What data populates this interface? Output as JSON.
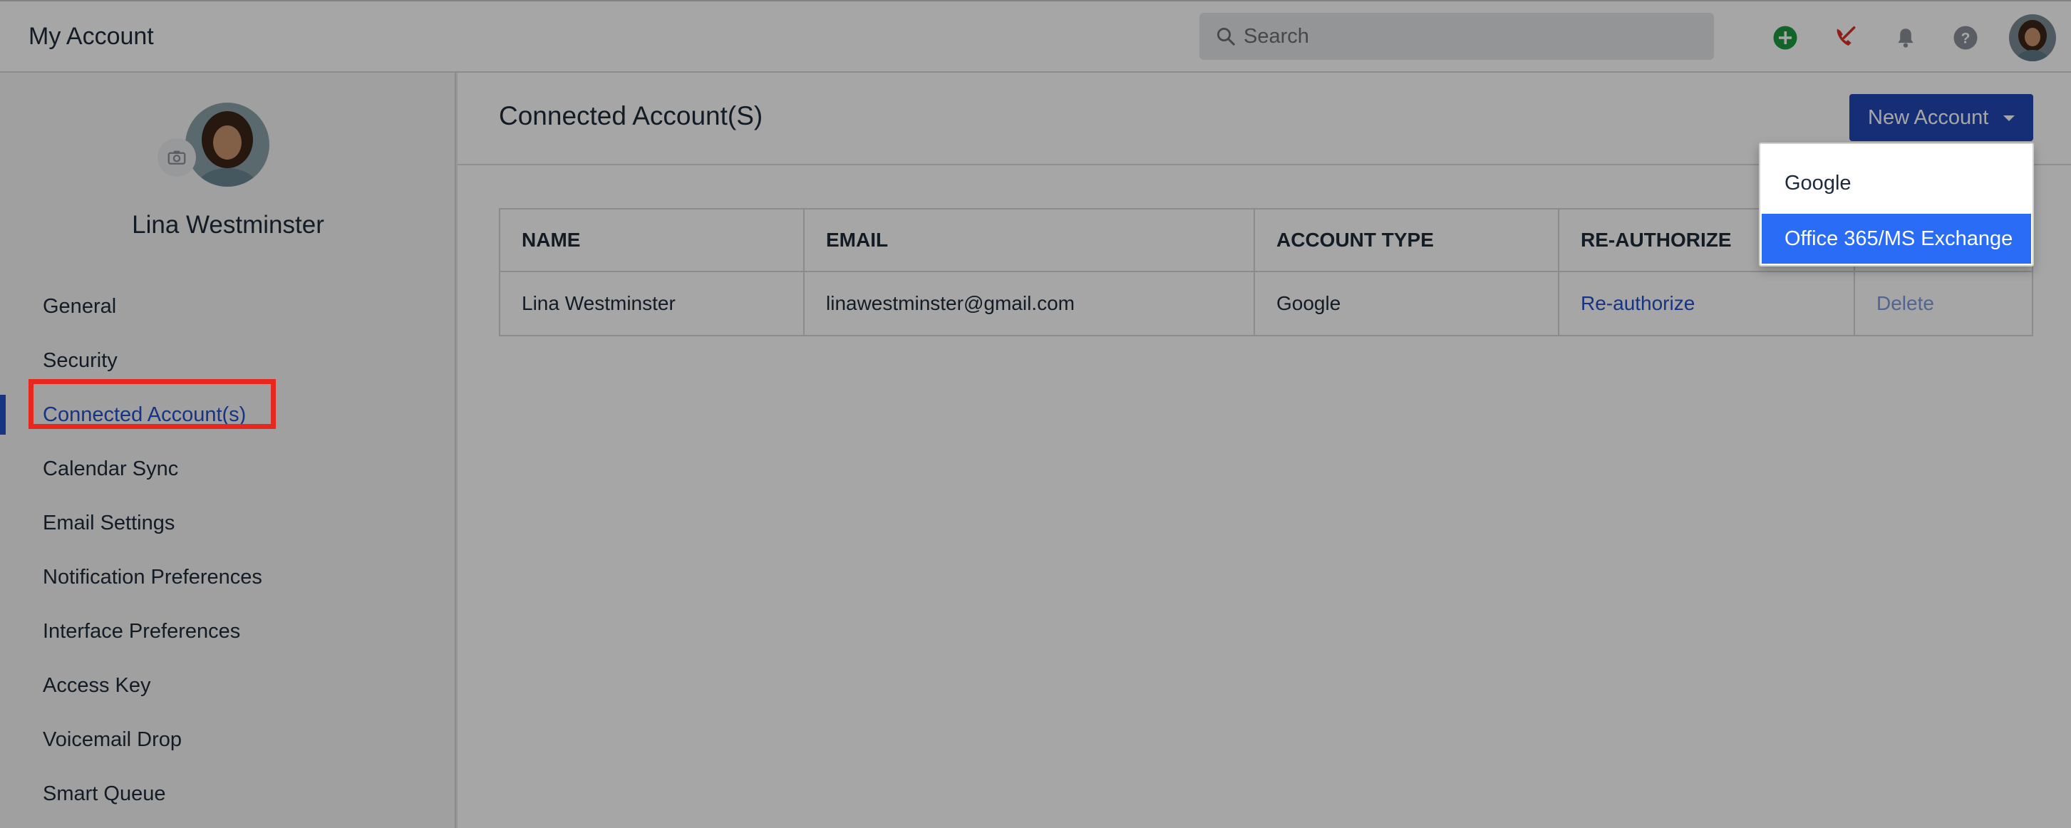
{
  "header": {
    "title": "My Account",
    "search_placeholder": "Search",
    "icons": [
      "add-circle-icon",
      "phone-off-icon",
      "bell-icon",
      "help-icon"
    ]
  },
  "profile": {
    "name": "Lina Westminster"
  },
  "sidebar": {
    "items": [
      {
        "label": "General"
      },
      {
        "label": "Security"
      },
      {
        "label": "Connected Account(s)",
        "active": true
      },
      {
        "label": "Calendar Sync"
      },
      {
        "label": "Email Settings"
      },
      {
        "label": "Notification Preferences"
      },
      {
        "label": "Interface Preferences"
      },
      {
        "label": "Access Key"
      },
      {
        "label": "Voicemail Drop"
      },
      {
        "label": "Smart Queue"
      }
    ]
  },
  "main": {
    "title": "Connected Account(S)",
    "new_button_label": "New Account",
    "table": {
      "columns": [
        "NAME",
        "EMAIL",
        "ACCOUNT TYPE",
        "RE-AUTHORIZE",
        ""
      ],
      "rows": [
        {
          "name": "Lina Westminster",
          "email": "linawestminster@gmail.com",
          "type": "Google",
          "reauth": "Re-authorize",
          "delete": "Delete"
        }
      ]
    }
  },
  "dropdown": {
    "options": [
      "Google",
      "Office 365/MS Exchange"
    ],
    "selected_index": 1
  },
  "colors": {
    "accent": "#2251c9",
    "button": "#2348b5",
    "selected_option": "#2a6cf5",
    "highlight_box": "#e8281e",
    "add_icon": "#1c9a3e",
    "phone_icon": "#d93025"
  }
}
